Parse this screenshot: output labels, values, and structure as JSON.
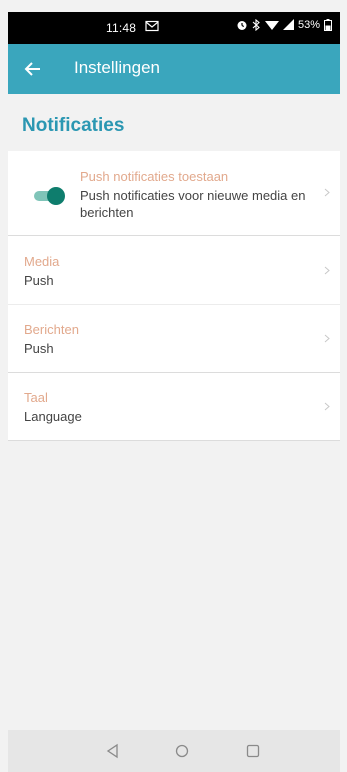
{
  "status": {
    "time": "11:48",
    "battery": "53%"
  },
  "appbar": {
    "title": "Instellingen"
  },
  "section": {
    "title": "Notificaties"
  },
  "push": {
    "title": "Push notificaties toestaan",
    "description": "Push notificaties voor nieuwe media en berichten",
    "enabled": true
  },
  "rows": [
    {
      "label": "Media",
      "value": "Push"
    },
    {
      "label": "Berichten",
      "value": "Push"
    },
    {
      "label": "Taal",
      "value": "Language"
    }
  ],
  "colors": {
    "accent": "#3aa6bd",
    "section_title": "#2b97b2",
    "label": "#e2a98d",
    "toggle_on": "#0e7d6d"
  },
  "icons": [
    "back-arrow-icon",
    "mail-icon",
    "alarm-icon",
    "bluetooth-icon",
    "wifi-icon",
    "signal-icon",
    "battery-icon",
    "chevron-right-icon",
    "nav-back-icon",
    "nav-home-icon",
    "nav-recents-icon"
  ]
}
